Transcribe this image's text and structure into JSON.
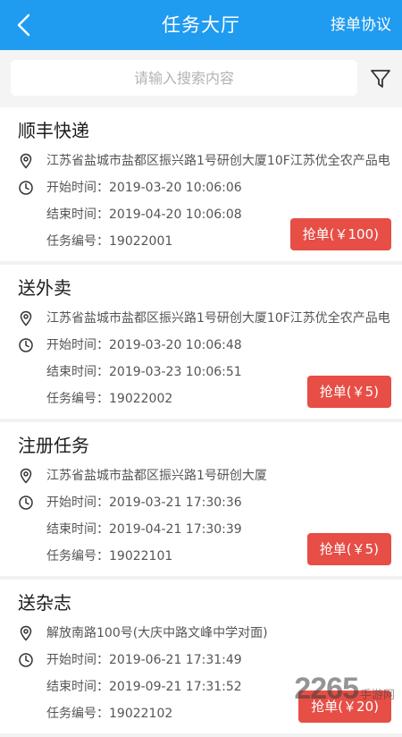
{
  "header": {
    "title": "任务大厅",
    "agreement_label": "接单协议"
  },
  "search": {
    "placeholder": "请输入搜索内容",
    "value": ""
  },
  "icons": {
    "back": "back-arrow-icon",
    "filter": "filter-funnel-icon",
    "location": "location-pin-icon",
    "clock": "clock-icon"
  },
  "colors": {
    "primary": "#1f9bf0",
    "grab_button": "#e64e46"
  },
  "labels": {
    "start": "开始时间：",
    "end": "结束时间：",
    "task_no": "任务编号："
  },
  "tasks": [
    {
      "title": "顺丰快递",
      "address": "江苏省盐城市盐都区振兴路1号研创大厦10F江苏优全农产品电",
      "start_time": "2019-03-20 10:06:06",
      "end_time": "2019-04-20 10:06:08",
      "task_no": "19022001",
      "button": "抢单(￥100)"
    },
    {
      "title": "送外卖",
      "address": "江苏省盐城市盐都区振兴路1号研创大厦10F江苏优全农产品电",
      "start_time": "2019-03-20 10:06:48",
      "end_time": "2019-03-23 10:06:51",
      "task_no": "19022002",
      "button": "抢单(￥5)"
    },
    {
      "title": "注册任务",
      "address": "江苏省盐城市盐都区振兴路1号研创大厦",
      "start_time": "2019-03-21 17:30:36",
      "end_time": "2019-04-21 17:30:39",
      "task_no": "19022101",
      "button": "抢单(￥5)"
    },
    {
      "title": "送杂志",
      "address": "解放南路100号(大庆中路文峰中学对面)",
      "start_time": "2019-06-21 17:31:49",
      "end_time": "2019-09-21 17:31:52",
      "task_no": "19022102",
      "button": "抢单(￥20)"
    }
  ],
  "watermark": {
    "main": "2265",
    "sub": "手游网"
  }
}
